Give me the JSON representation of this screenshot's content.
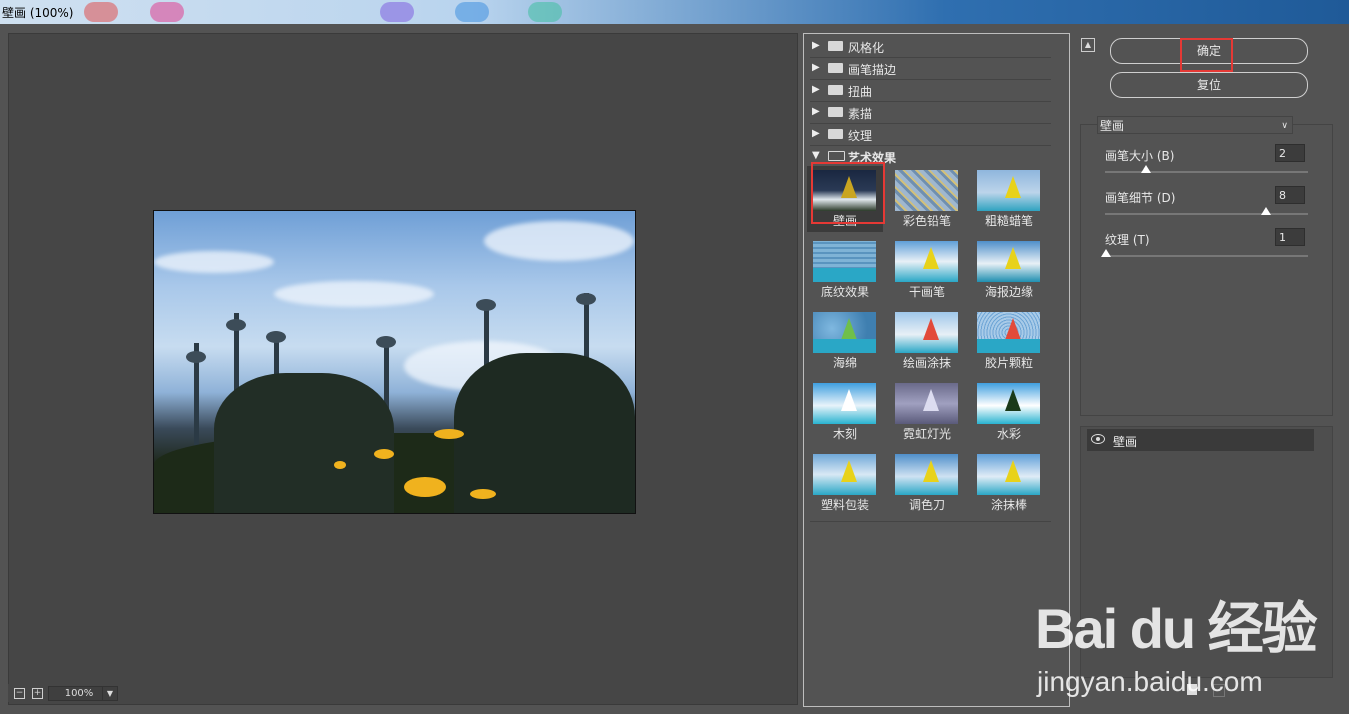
{
  "window": {
    "title": "壁画 (100%)"
  },
  "preview": {
    "zoom": "100%"
  },
  "gallery": {
    "categories": [
      {
        "label": "风格化",
        "expanded": false
      },
      {
        "label": "画笔描边",
        "expanded": false
      },
      {
        "label": "扭曲",
        "expanded": false
      },
      {
        "label": "素描",
        "expanded": false
      },
      {
        "label": "纹理",
        "expanded": false
      },
      {
        "label": "艺术效果",
        "expanded": true
      }
    ],
    "filters": [
      "壁画",
      "彩色铅笔",
      "粗糙蜡笔",
      "底纹效果",
      "干画笔",
      "海报边缘",
      "海绵",
      "绘画涂抹",
      "胶片颗粒",
      "木刻",
      "霓虹灯光",
      "水彩",
      "塑料包装",
      "调色刀",
      "涂抹棒"
    ],
    "selected": "壁画"
  },
  "panel": {
    "ok_label": "确定",
    "reset_label": "复位",
    "filter_select": "壁画",
    "params": [
      {
        "label": "画笔大小 (B)",
        "value": "2",
        "level": 0.2
      },
      {
        "label": "画笔细节 (D)",
        "value": "8",
        "level": 0.8
      },
      {
        "label": "纹理 (T)",
        "value": "1",
        "level": 0.0
      }
    ],
    "layer_name": "壁画"
  },
  "watermark": {
    "brand": "Bai du 经验",
    "url": "jingyan.baidu.com"
  },
  "colors": {
    "accent_red": "#e53935",
    "background": "#535353"
  }
}
